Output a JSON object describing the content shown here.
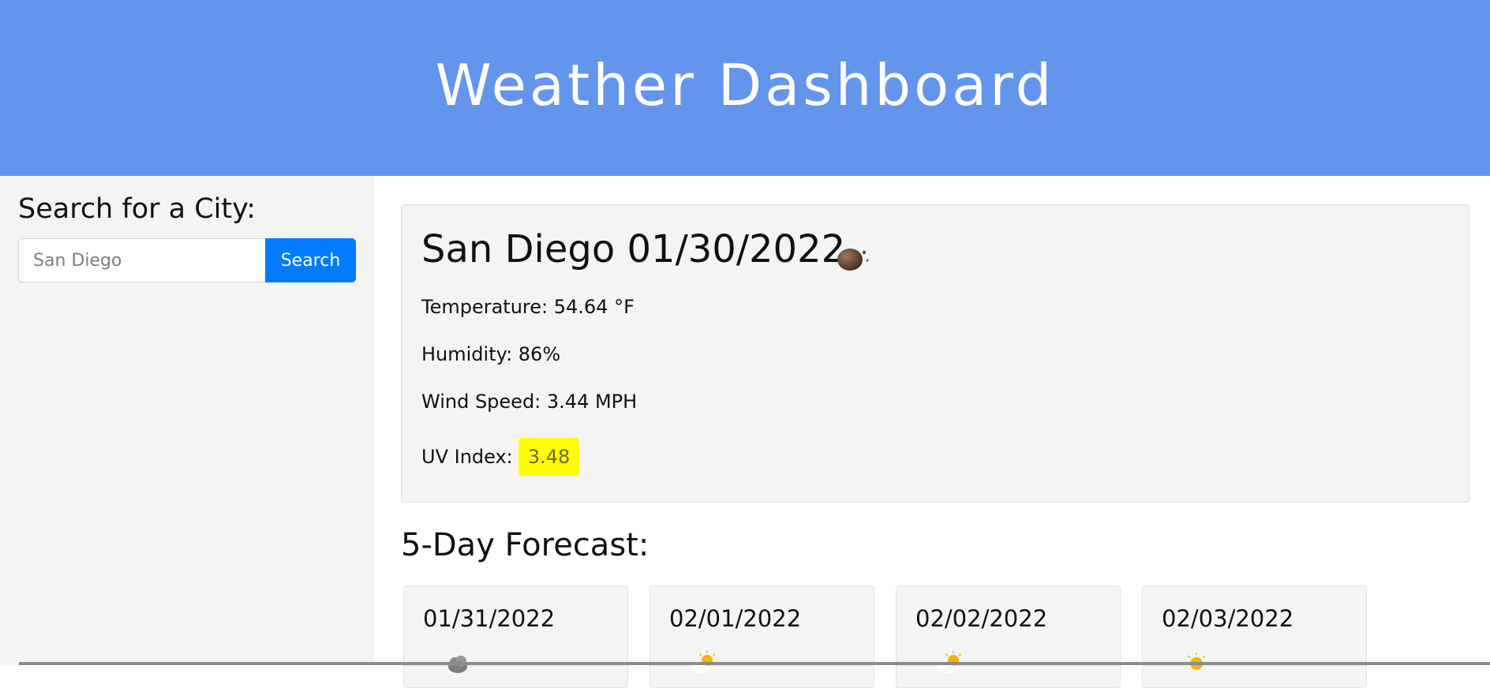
{
  "header": {
    "title": "Weather Dashboard",
    "background_color": "#6495ed"
  },
  "sidebar": {
    "heading": "Search for a City:",
    "search": {
      "value": "",
      "placeholder": "San Diego"
    },
    "search_button_label": "Search"
  },
  "current": {
    "city_date": "San Diego 01/30/2022",
    "icon": "moon-icon",
    "temperature": "Temperature: 54.64 °F",
    "humidity": "Humidity: 86%",
    "wind_speed": "Wind Speed: 3.44 MPH",
    "uv_label": "UV Index:",
    "uv_value": "3.48",
    "uv_color": "#ffff00"
  },
  "forecast": {
    "heading": "5-Day Forecast:",
    "days": [
      {
        "date": "01/31/2022",
        "icon": "cloud-icon"
      },
      {
        "date": "02/01/2022",
        "icon": "sun-cloud-icon"
      },
      {
        "date": "02/02/2022",
        "icon": "sun-cloud-icon"
      },
      {
        "date": "02/03/2022",
        "icon": "sun-icon"
      }
    ]
  },
  "colors": {
    "accent": "#007bff",
    "panel": "#f4f4f4"
  }
}
